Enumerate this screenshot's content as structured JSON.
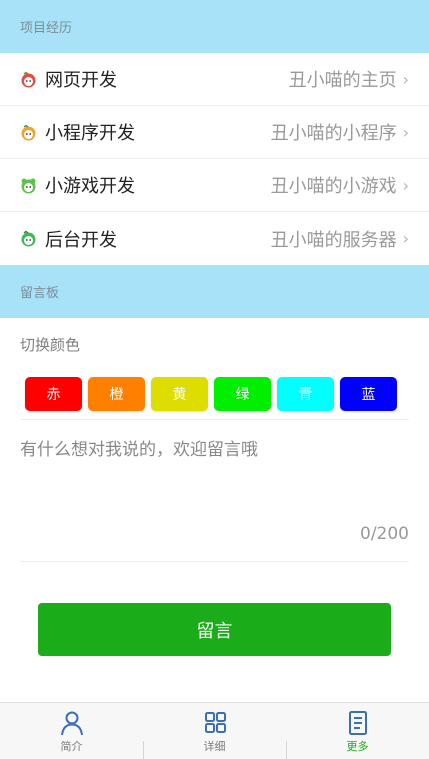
{
  "projects": {
    "title": "项目经历",
    "items": [
      {
        "name": "网页开发",
        "link": "丑小喵的主页",
        "icon": "red-head-icon",
        "color": "#e54d42"
      },
      {
        "name": "小程序开发",
        "link": "丑小喵的小程序",
        "icon": "orange-head-icon",
        "color": "#f3a32b"
      },
      {
        "name": "小游戏开发",
        "link": "丑小喵的小游戏",
        "icon": "green-head-icon",
        "color": "#5cc24a"
      },
      {
        "name": "后台开发",
        "link": "丑小喵的服务器",
        "icon": "green-head-icon",
        "color": "#3dba5a"
      }
    ]
  },
  "board": {
    "title": "留言板",
    "toggle_label": "切换颜色",
    "colors": [
      {
        "label": "赤",
        "color": "#ff0000"
      },
      {
        "label": "橙",
        "color": "#ff7f00"
      },
      {
        "label": "黄",
        "color": "#dddd00"
      },
      {
        "label": "绿",
        "color": "#00ee00"
      },
      {
        "label": "青",
        "color": "#00ffff"
      },
      {
        "label": "蓝",
        "color": "#0000ff"
      }
    ],
    "placeholder": "有什么想对我说的，欢迎留言哦",
    "counter": "0/200",
    "submit_label": "留言"
  },
  "tabbar": {
    "tabs": [
      {
        "label": "简介",
        "icon": "user-icon",
        "active": false
      },
      {
        "label": "详细",
        "icon": "grid-icon",
        "active": false
      },
      {
        "label": "更多",
        "icon": "document-icon",
        "active": true
      }
    ],
    "accent": "#1aad19"
  }
}
